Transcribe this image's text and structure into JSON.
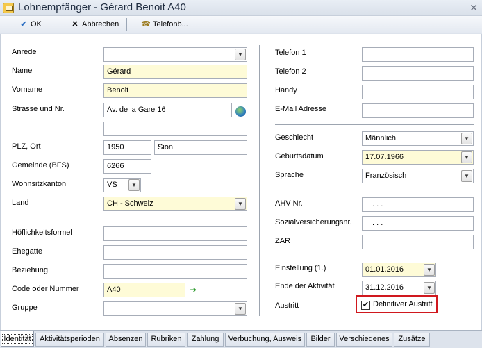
{
  "window": {
    "title": "Lohnempfänger - Gérard Benoit A40",
    "close": "✕"
  },
  "toolbar": {
    "ok": "OK",
    "cancel": "Abbrechen",
    "phonebook": "Telefonb..."
  },
  "left": {
    "anrede": {
      "label": "Anrede",
      "value": ""
    },
    "name": {
      "label": "Name",
      "value": "Gérard"
    },
    "vorname": {
      "label": "Vorname",
      "value": "Benoit"
    },
    "strasse": {
      "label": "Strasse und Nr.",
      "value": "Av. de la Gare 16",
      "value2": ""
    },
    "plz_ort": {
      "label": "PLZ, Ort",
      "plz": "1950",
      "ort": "Sion"
    },
    "gemeinde": {
      "label": "Gemeinde (BFS)",
      "value": "6266"
    },
    "kanton": {
      "label": "Wohnsitzkanton",
      "value": "VS"
    },
    "land": {
      "label": "Land",
      "value": "CH - Schweiz"
    },
    "hoeflichkeit": {
      "label": "Höflichkeitsformel",
      "value": ""
    },
    "ehegatte": {
      "label": "Ehegatte",
      "value": ""
    },
    "beziehung": {
      "label": "Beziehung",
      "value": ""
    },
    "code": {
      "label": "Code oder Nummer",
      "value": "A40"
    },
    "gruppe": {
      "label": "Gruppe",
      "value": ""
    }
  },
  "right": {
    "telefon1": {
      "label": "Telefon 1",
      "value": ""
    },
    "telefon2": {
      "label": "Telefon 2",
      "value": ""
    },
    "handy": {
      "label": "Handy",
      "value": ""
    },
    "email": {
      "label": "E-Mail Adresse",
      "value": ""
    },
    "geschlecht": {
      "label": "Geschlecht",
      "value": "Männlich"
    },
    "geburtsdatum": {
      "label": "Geburtsdatum",
      "value": "17.07.1966"
    },
    "sprache": {
      "label": "Sprache",
      "value": "Französisch"
    },
    "ahv": {
      "label": "AHV Nr.",
      "value": ". . ."
    },
    "sozial": {
      "label": "Sozialversicherungsnr.",
      "value": ". . ."
    },
    "zar": {
      "label": "ZAR",
      "value": ""
    },
    "einstellung": {
      "label": "Einstellung (1.)",
      "value": "01.01.2016"
    },
    "ende": {
      "label": "Ende der Aktivität",
      "value": "31.12.2016"
    },
    "austritt": {
      "label": "Austritt",
      "checkbox_label": "Definitiver Austritt",
      "checked": true
    }
  },
  "tabs": [
    "Identität",
    "Aktivitätsperioden",
    "Absenzen",
    "Rubriken",
    "Zahlung",
    "Verbuchung, Ausweis",
    "Bilder",
    "Verschiedenes",
    "Zusätze"
  ],
  "icons": {
    "dropdown": "▼",
    "checkmark": "✔",
    "ok_icon": "check-icon",
    "cancel_icon": "close-icon",
    "phone_icon": "phone-icon",
    "globe_icon": "globe-icon",
    "link_icon": "arrow-icon"
  },
  "colors": {
    "required_field": "#fefbd7",
    "highlight_border": "#d0181e"
  }
}
